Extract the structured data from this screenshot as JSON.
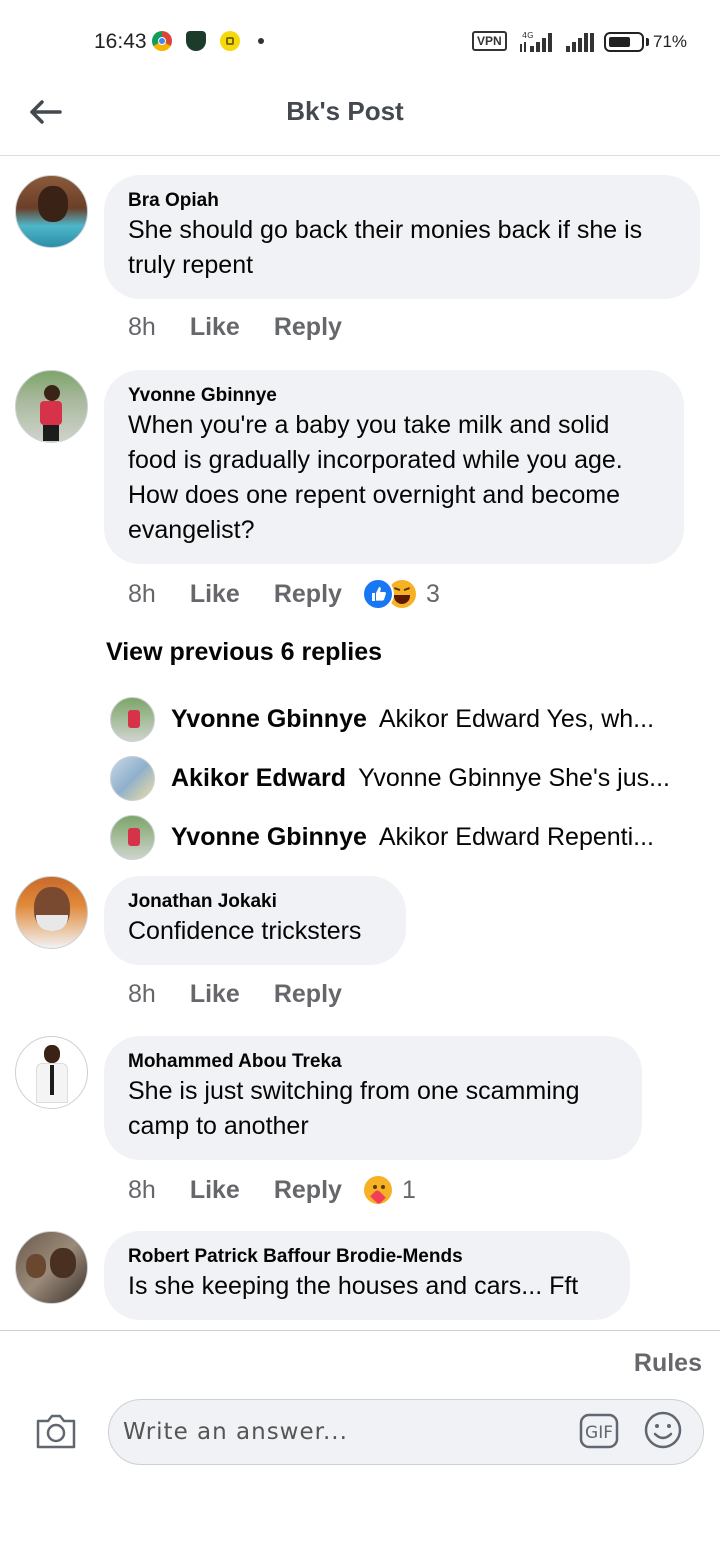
{
  "status_bar": {
    "time": "16:43",
    "network_label": "4G",
    "vpn_label": "VPN",
    "battery_percent": "71%",
    "battery_level": 0.71
  },
  "header": {
    "title": "Bk's Post",
    "back_icon": "arrow-left-icon"
  },
  "comments": [
    {
      "author": "Bra Opiah",
      "lines": [
        "She should go back their monies back if she is",
        "truly repent"
      ],
      "time": "8h",
      "like_label": "Like",
      "reply_label": "Reply"
    },
    {
      "author": "Yvonne Gbinnye",
      "lines": [
        "When you're a baby you take milk and solid",
        "food is gradually incorporated while you age.",
        "How does one repent overnight and become",
        "evangelist?"
      ],
      "time": "8h",
      "like_label": "Like",
      "reply_label": "Reply",
      "reactions": [
        "like",
        "haha"
      ],
      "reaction_count": "3"
    },
    {
      "author": "Jonathan Jokaki",
      "lines": [
        "Confidence tricksters"
      ],
      "time": "8h",
      "like_label": "Like",
      "reply_label": "Reply"
    },
    {
      "author": "Mohammed Abou Treka",
      "lines": [
        "She is just switching from one scamming",
        "camp to another"
      ],
      "time": "8h",
      "like_label": "Like",
      "reply_label": "Reply",
      "reactions": [
        "care"
      ],
      "reaction_count": "1"
    },
    {
      "author": "Robert Patrick Baffour Brodie-Mends",
      "lines": [
        "Is she keeping the houses and cars... Fft"
      ]
    }
  ],
  "replies_thread": {
    "view_previous_label": "View previous 6 replies",
    "replies": [
      {
        "author": "Yvonne Gbinnye",
        "text": "Akikor Edward Yes, wh..."
      },
      {
        "author": "Akikor Edward",
        "text": "Yvonne Gbinnye She's jus..."
      },
      {
        "author": "Yvonne Gbinnye",
        "text": "Akikor Edward Repenti..."
      }
    ]
  },
  "composer": {
    "rules_label": "Rules",
    "placeholder": "Write an answer...",
    "camera_icon": "camera-icon",
    "gif_icon": "gif-icon",
    "emoji_icon": "smiley-icon"
  },
  "colors": {
    "bubble_bg": "#f0f2f5",
    "secondary_text": "#65676b",
    "like_blue": "#1877f2",
    "haha_yellow": "#f7b125"
  }
}
